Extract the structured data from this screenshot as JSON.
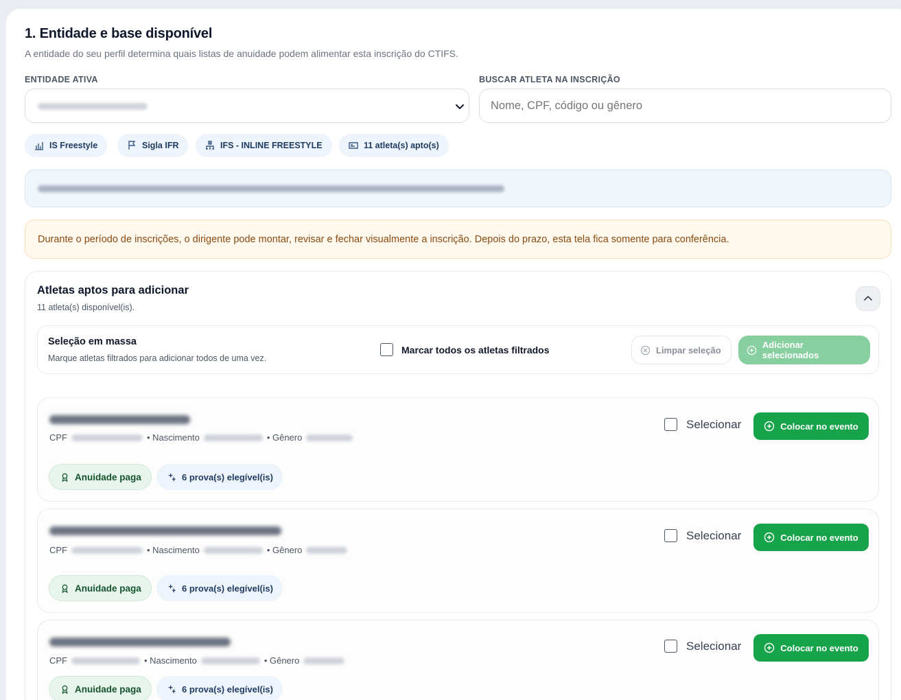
{
  "section": {
    "title": "1. Entidade e base disponível",
    "subtitle": "A entidade do seu perfil determina quais listas de anuidade podem alimentar esta inscrição do CTIFS."
  },
  "entity": {
    "label": "ENTIDADE ATIVA"
  },
  "search": {
    "label": "BUSCAR ATLETA NA INSCRIÇÃO",
    "placeholder": "Nome, CPF, código ou gênero"
  },
  "pills": [
    {
      "icon": "bar-chart-icon",
      "label": "IS Freestyle"
    },
    {
      "icon": "flag-icon",
      "label": "Sigla IFR"
    },
    {
      "icon": "hierarchy-icon",
      "label": "IFS - INLINE FREESTYLE"
    },
    {
      "icon": "id-card-icon",
      "label": "11 atleta(s) apto(s)"
    }
  ],
  "warning": "Durante o período de inscrições, o dirigente pode montar, revisar e fechar visualmente a inscrição. Depois do prazo, esta tela fica somente para conferência.",
  "athletes_panel": {
    "title": "Atletas aptos para adicionar",
    "count": "11 atleta(s) disponível(is)."
  },
  "mass_selection": {
    "title": "Seleção em massa",
    "subtitle": "Marque atletas filtrados para adicionar todos de uma vez.",
    "check_all_label": "Marcar todos os atletas filtrados",
    "clear_label": "Limpar seleção",
    "add_selected_label": "Adicionar selecionados"
  },
  "athlete_card": {
    "cpf_label": "CPF",
    "birth_label": "• Nascimento",
    "gender_label": "• Gênero",
    "select_label": "Selecionar",
    "add_button": "Colocar no evento",
    "paid_badge": "Anuidade paga",
    "events_badge": "6 prova(s) elegível(is)"
  },
  "colors": {
    "accent_green": "#16a34a",
    "dim_green": "#88cfa0",
    "warning_bg": "#fff8ed",
    "warning_text": "#8a4b12"
  }
}
